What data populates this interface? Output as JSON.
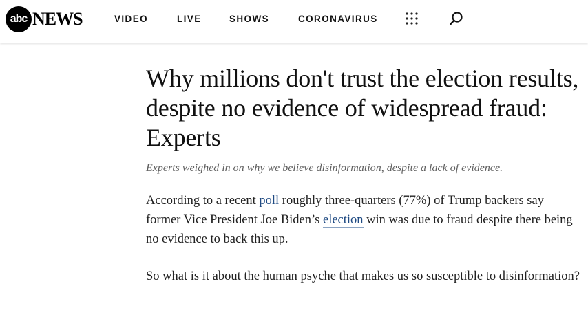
{
  "header": {
    "logo_abc": "abc",
    "logo_news": "NEWS",
    "nav": [
      {
        "label": "VIDEO"
      },
      {
        "label": "LIVE"
      },
      {
        "label": "SHOWS"
      },
      {
        "label": "CORONAVIRUS"
      }
    ],
    "icons": {
      "menu": "grid-menu-icon",
      "search": "search-icon"
    }
  },
  "article": {
    "headline": "Why millions don't trust the election results, despite no evidence of widespread fraud: Experts",
    "subhead": "Experts weighed in on why we believe disinformation, despite a lack of evidence.",
    "paragraph1": {
      "part1": "According to a recent ",
      "link1": "poll",
      "part2": " roughly three-quarters (77%) of Trump backers say former Vice President Joe Biden’s ",
      "link2": "election",
      "part3": " win was due to fraud despite there being no evidence to back this up."
    },
    "paragraph2": "So what is it about the human psyche that makes us so susceptible to disinformation?"
  },
  "colors": {
    "link": "#1f4a82",
    "subhead": "#5f5f5f",
    "text": "#222222"
  }
}
